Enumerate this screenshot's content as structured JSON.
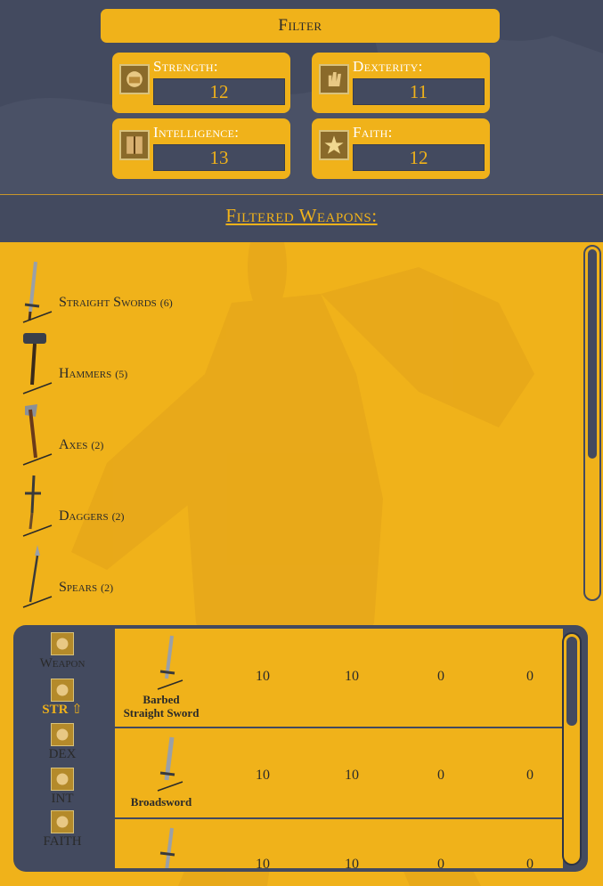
{
  "filter": {
    "title": "Filter"
  },
  "stats": [
    {
      "label": "Strength:",
      "value": "12",
      "icon": "fist-icon"
    },
    {
      "label": "Dexterity:",
      "value": "11",
      "icon": "hand-icon"
    },
    {
      "label": "Intelligence:",
      "value": "13",
      "icon": "book-icon"
    },
    {
      "label": "Faith:",
      "value": "12",
      "icon": "star-icon"
    }
  ],
  "filtered_title": "Filtered Weapons:",
  "categories": [
    {
      "name": "Straight Swords",
      "count": "(6)",
      "icon": "straight-sword-icon"
    },
    {
      "name": "Hammers",
      "count": "(5)",
      "icon": "hammer-icon"
    },
    {
      "name": "Axes",
      "count": "(2)",
      "icon": "axe-icon"
    },
    {
      "name": "Daggers",
      "count": "(2)",
      "icon": "dagger-icon"
    },
    {
      "name": "Spears",
      "count": "(2)",
      "icon": "spear-icon"
    }
  ],
  "sort_columns": [
    {
      "label": "Weapon"
    },
    {
      "label": "STR ⇧",
      "active": true
    },
    {
      "label": "DEX"
    },
    {
      "label": "INT"
    },
    {
      "label": "FAITH"
    }
  ],
  "weapons": [
    {
      "name_line1": "Barbed",
      "name_line2": "Straight Sword",
      "str": "10",
      "dex": "10",
      "int": "0",
      "faith": "0"
    },
    {
      "name_line1": "Broadsword",
      "name_line2": "",
      "str": "10",
      "dex": "10",
      "int": "0",
      "faith": "0"
    },
    {
      "name_line1": "",
      "name_line2": "",
      "str": "10",
      "dex": "10",
      "int": "0",
      "faith": "0"
    }
  ],
  "colors": {
    "accent": "#f0b21a",
    "panel": "#434a5f",
    "text": "#2a2a2a"
  }
}
